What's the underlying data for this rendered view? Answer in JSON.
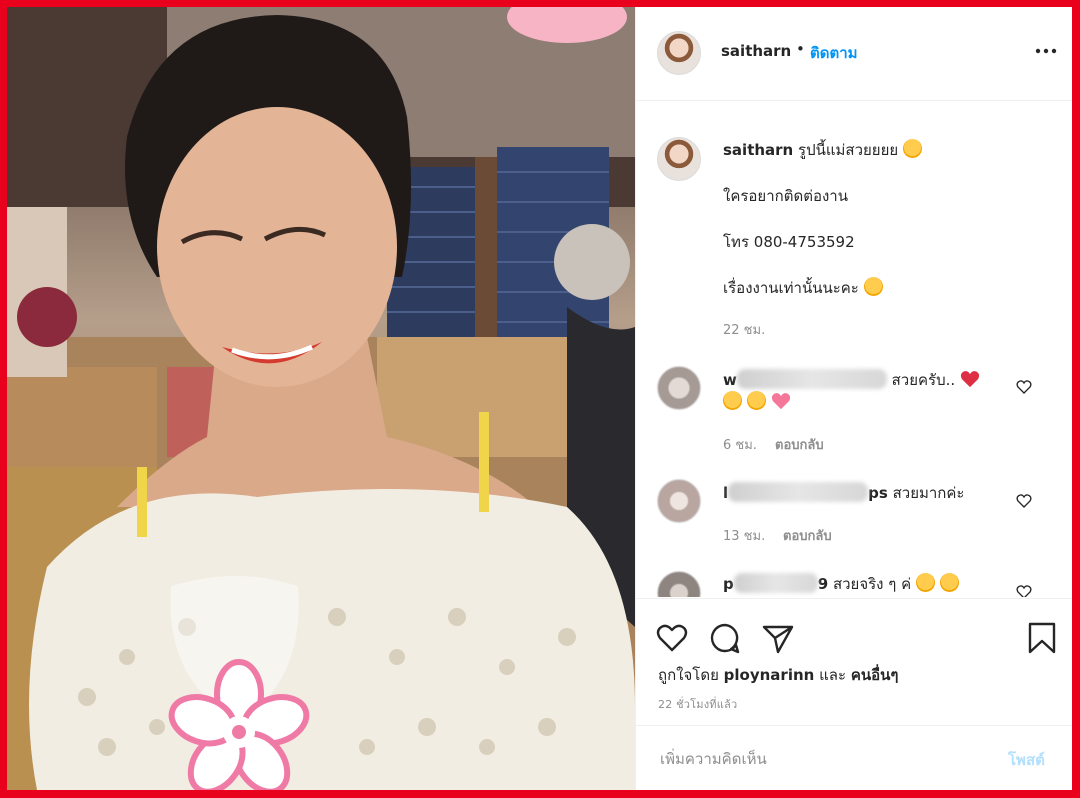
{
  "post": {
    "owner_username": "saitharn",
    "follow_separator": "•",
    "follow_label": "ติดตาม",
    "caption_lines": [
      "รูปนี้แม่สวยยยย",
      "ใครอยากติดต่องาน",
      "โทร 080-4753592",
      "เรื่องงานเท่านั้นนะคะ"
    ],
    "caption_time": "22 ชม.",
    "comments": [
      {
        "name_visible_prefix": "w",
        "text": "สวยครับ..",
        "time": "6 ชม.",
        "reply_label": "ตอบกลับ"
      },
      {
        "name_visible_prefix": "l",
        "name_visible_suffix": "ps",
        "text": "สวยมากค่ะ",
        "time": "13 ชม.",
        "reply_label": "ตอบกลับ"
      },
      {
        "name_visible_prefix": "p",
        "name_visible_suffix": "9",
        "text": "สวยจริง ๆ ค่"
      }
    ],
    "likes_prefix": "ถูกใจโดย",
    "likes_user": "ploynarinn",
    "likes_and": "และ",
    "likes_others": "คนอื่นๆ",
    "time_ago": "22 ชั่วโมงที่แล้ว",
    "comment_placeholder": "เพิ่มความคิดเห็น",
    "post_button": "โพสต์"
  },
  "colors": {
    "frame_border": "#e8001c",
    "link_blue": "#0095f6",
    "post_disabled": "#b2dffc",
    "muted_text": "#8e8e8e"
  },
  "icons": {
    "header": "more-horizontal-icon",
    "actions": [
      "heart-icon",
      "comment-icon",
      "share-icon",
      "bookmark-icon"
    ]
  }
}
